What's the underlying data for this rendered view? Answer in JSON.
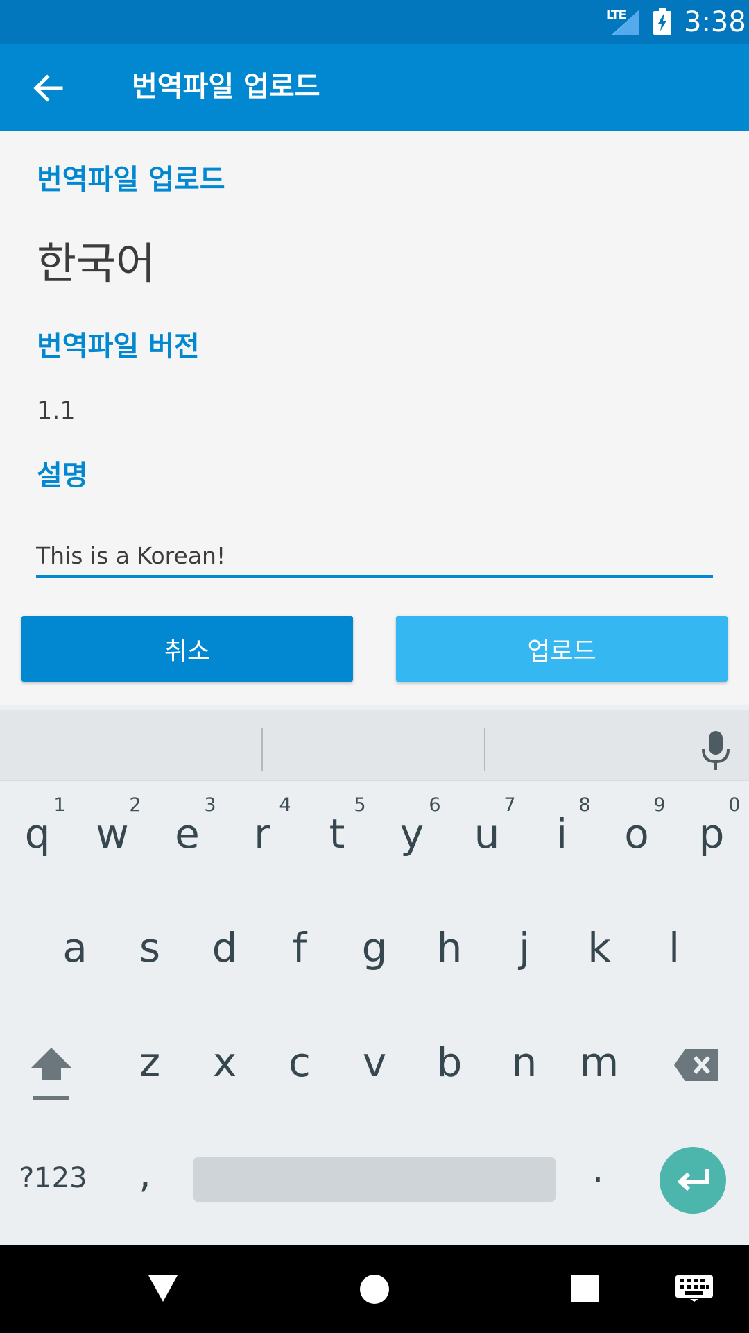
{
  "status_bar": {
    "network": "LTE",
    "time": "3:38"
  },
  "app_bar": {
    "title": "번역파일 업로드"
  },
  "form": {
    "upload_label": "번역파일 업로드",
    "language_value": "한국어",
    "version_label": "번역파일 버전",
    "version_value": "1.1",
    "description_label": "설명",
    "description_value": "This is a Korean!"
  },
  "buttons": {
    "cancel": "취소",
    "upload": "업로드"
  },
  "keyboard": {
    "row1": [
      "q",
      "w",
      "e",
      "r",
      "t",
      "y",
      "u",
      "i",
      "o",
      "p"
    ],
    "row1_hints": [
      "1",
      "2",
      "3",
      "4",
      "5",
      "6",
      "7",
      "8",
      "9",
      "0"
    ],
    "row2": [
      "a",
      "s",
      "d",
      "f",
      "g",
      "h",
      "j",
      "k",
      "l"
    ],
    "row3": [
      "z",
      "x",
      "c",
      "v",
      "b",
      "n",
      "m"
    ],
    "symbols": "?123",
    "comma": ",",
    "period": "."
  },
  "colors": {
    "status_bar": "#0277bd",
    "app_bar": "#0288d1",
    "accent": "#0288d1",
    "upload_button": "#35b7f1",
    "enter_key": "#4db6ac"
  }
}
